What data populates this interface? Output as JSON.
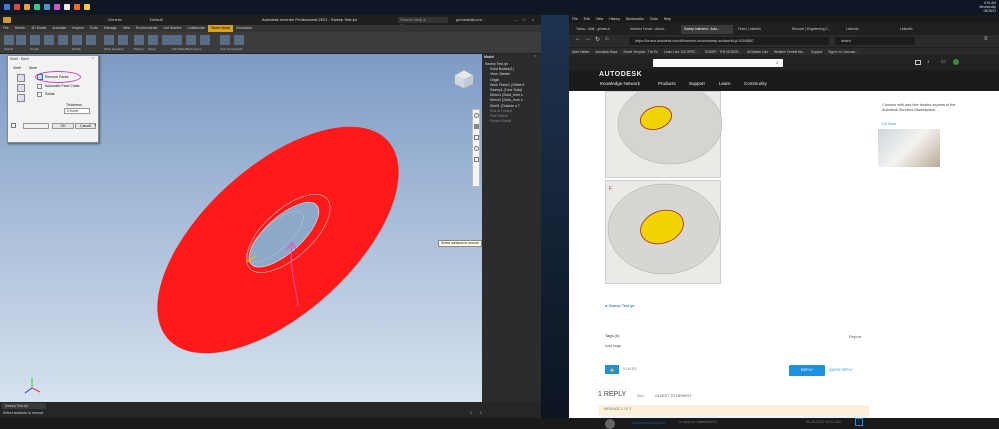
{
  "taskbar": {
    "clock": "8:51 AM",
    "day": "Wednesday",
    "date": "05/26/21"
  },
  "inventor": {
    "search_placeholder": "Search Help & Commands...",
    "title": "Autodesk Inventor Professional 2021 - Sweep Test.ipt",
    "user": "grimesb@corn...",
    "quick_style": "Generic",
    "quick_style2": "Default",
    "ribbon_tabs": [
      "File",
      "Sketch",
      "3D Model",
      "Annotate",
      "Inspect",
      "Tools",
      "Manage",
      "View",
      "Environments",
      "Get Started",
      "Collaborate",
      "Sheet Metal",
      "Simulation"
    ],
    "active_tab": "Sheet Metal",
    "ribbon_groups": [
      "Sketch",
      "Create",
      "Modify",
      "Work Features",
      "Pattern",
      "Setup",
      "Flat Pattern",
      "Parameters",
      "User Commands"
    ],
    "model_browser": {
      "title": "Model",
      "items": [
        "Sweep Test.ipt",
        "Solid Bodies(1)",
        "View: Master",
        "Origin",
        "Work Plane1 (Offset fr",
        "Sweep1 (Tone Solid)",
        "Mirror1 (Solid_from s",
        "Mirror2 (Solid_from s",
        "Shell1 (Outside o.T",
        "End of Folded",
        "Flat Pattern",
        "Folded Model"
      ]
    },
    "tooltip": "Select surfaces to remove",
    "status_tab": "Sweep Test.ipt",
    "status_text": "Select surfaces to remove",
    "status_counts": [
      "1",
      "1"
    ],
    "dialog": {
      "title": "Shell : Shell",
      "tabs": [
        "Shell",
        "More"
      ],
      "options": [
        "Remove Faces",
        "Automatic Face Chain",
        "Solids"
      ],
      "thickness_label": "Thickness",
      "thickness_value": "2.5 mm",
      "ok": "OK",
      "cancel": "Cancel"
    }
  },
  "firefox": {
    "menu": [
      "File",
      "Edit",
      "View",
      "History",
      "Bookmarks",
      "Tools",
      "Help"
    ],
    "tabs": [
      "Yahoo - Mail - grimes.b",
      "Inventor Forum - Autod...",
      "Sweep Intersect - Auto...",
      "Feed | LinkedIn",
      "Recover | Engineering C...",
      "LinkedIn",
      "LinkedIn"
    ],
    "url": "https://forums.autodesk.com/t5/inventor-forum/sweep-surface/td-p/10345887",
    "search_value": "desert",
    "bookmarks": [
      "Most Visited",
      "Autodesk Maps",
      "Sweet Tempest - The Pri",
      "Learn Live: 100 SPEC ...",
      "ENGER - THE MODER...",
      "All Master Can",
      "Weather Central Ma...",
      "Support",
      "Sign in to Comcast..."
    ],
    "site": {
      "logo": "AUTODESK",
      "nav_title": "Knowledge Network",
      "nav_items": [
        "Products",
        "Support",
        "Learn",
        "Community"
      ],
      "sidebar_text": "Connect with and hire trusted experts of the Autodesk Services Marketplace.",
      "sidebar_link": "Go Now",
      "attachment": "Sweep Test.ipt",
      "tags_label": "Tags (0)",
      "add_tags": "Add tags",
      "report": "Report",
      "likes": "0 LIKES",
      "reply": "REPLY",
      "quick_reply": "QUICK REPLY",
      "replies": "1 REPLY",
      "sort_label": "Sort:",
      "sort_value": "OLDEST TO NEWEST",
      "message_meta": "MESSAGE 2 OF 2",
      "author": "alexanderboogaard",
      "in_reply_to": "in reply to: bailasMN/U3",
      "post_date": "05-26-2021 05:32 AM"
    }
  },
  "colors": {
    "accent": "#d9a21a",
    "brand_blue": "#1f8fe0",
    "torus": "#ff1a1a"
  }
}
